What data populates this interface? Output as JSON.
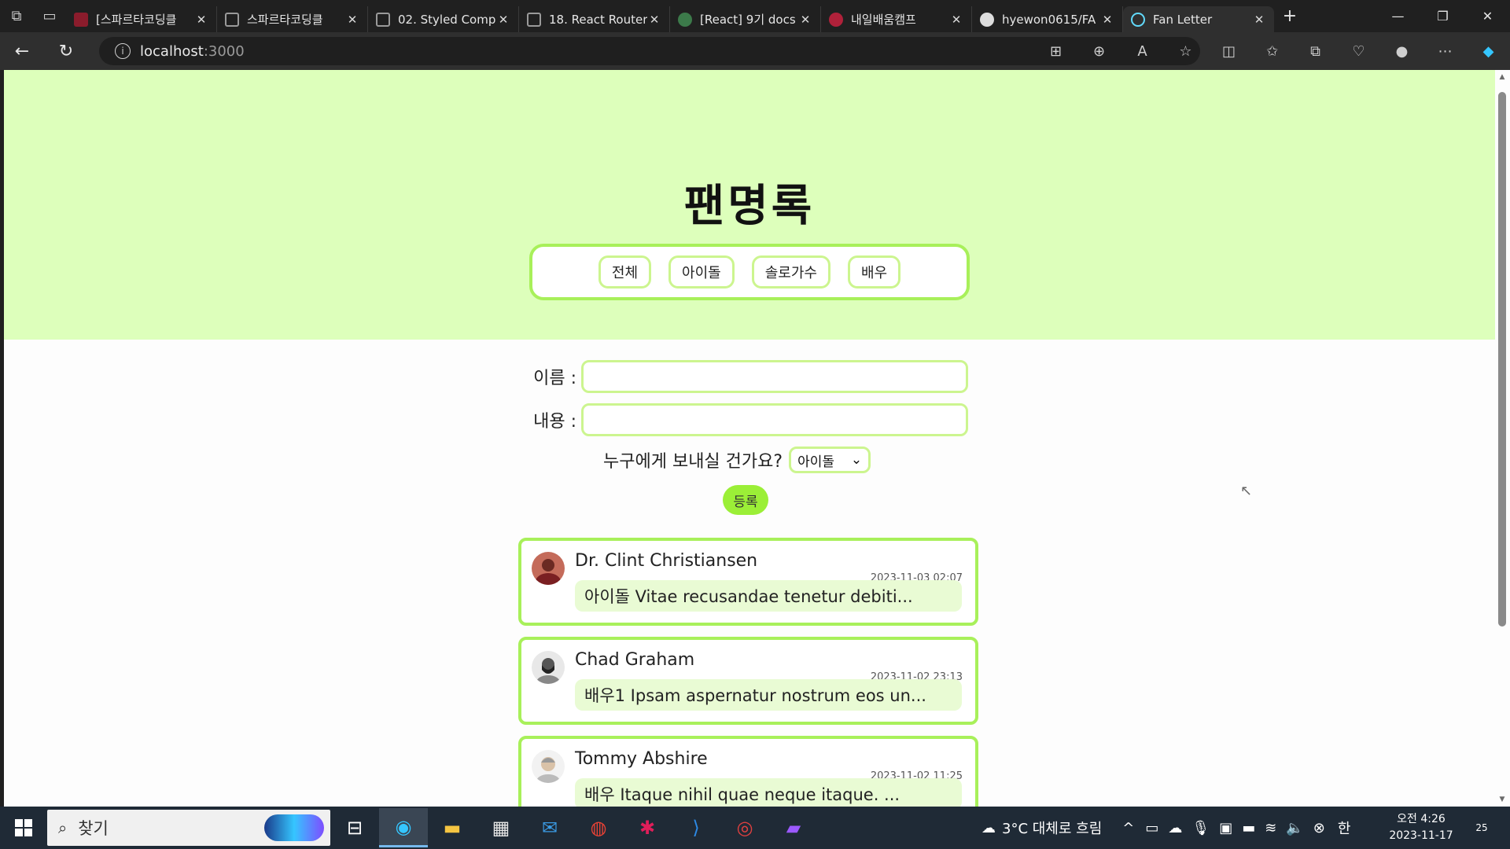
{
  "browser": {
    "tabs": [
      {
        "label": "[스파르타코딩클",
        "favicon_color": "#8b1c2c"
      },
      {
        "label": "스파르타코딩클",
        "favicon_color": "#5a5a5a"
      },
      {
        "label": "02. Styled Comp",
        "favicon_color": "#5a5a5a"
      },
      {
        "label": "18. React Router",
        "favicon_color": "#5a5a5a"
      },
      {
        "label": "[React] 9기 docs",
        "favicon_color": "#3c7a4a"
      },
      {
        "label": "내일배움캠프",
        "favicon_color": "#b0213a"
      },
      {
        "label": "hyewon0615/FA",
        "favicon_color": "#dddddd"
      },
      {
        "label": "Fan Letter",
        "favicon_color": "#61dafb"
      }
    ],
    "url_host": "localhost",
    "url_port": ":3000"
  },
  "page": {
    "title": "팬명록",
    "filters": [
      "전체",
      "아이돌",
      "솔로가수",
      "배우"
    ],
    "form": {
      "name_label": "이름 :",
      "content_label": "내용 :",
      "who_question": "누구에게 보내실 건가요?",
      "who_selected": "아이돌",
      "submit_label": "등록"
    },
    "letters": [
      {
        "name": "Dr. Clint Christiansen",
        "date": "2023-11-03 02:07",
        "content": "아이돌 Vitae recusandae tenetur debiti..."
      },
      {
        "name": "Chad Graham",
        "date": "2023-11-02 23:13",
        "content": "배우1 Ipsam aspernatur nostrum eos un..."
      },
      {
        "name": "Tommy Abshire",
        "date": "2023-11-02 11:25",
        "content": "배우 Itaque nihil quae neque itaque. ..."
      }
    ]
  },
  "taskbar": {
    "search_placeholder": "찾기",
    "weather": "3°C 대체로 흐림",
    "time": "오전 4:26",
    "date": "2023-11-17",
    "notification_count": "25"
  },
  "colors": {
    "hero_bg": "#ddffbb",
    "accent_border": "#a8f05a",
    "button_green": "#9bef37"
  }
}
